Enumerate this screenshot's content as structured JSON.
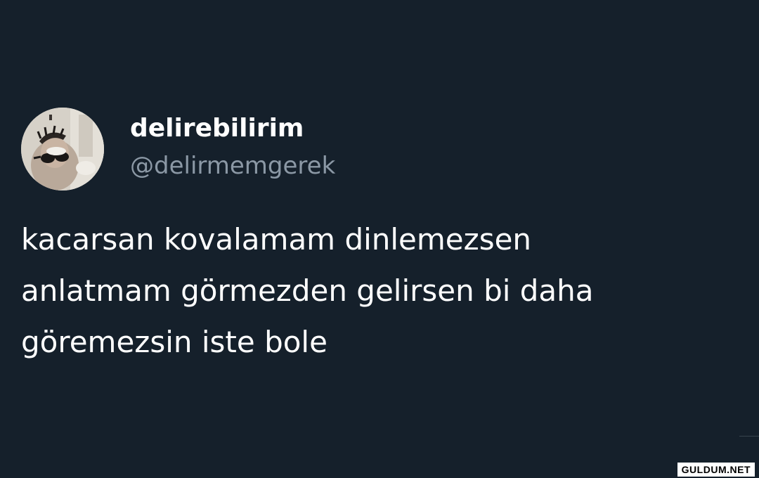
{
  "colors": {
    "background": "#15202b",
    "display_name": "#ffffff",
    "handle": "#8b98a5",
    "text": "#ffffff"
  },
  "author": {
    "display_name": "delirebilirim",
    "handle": "@delirmemgerek",
    "avatar_icon": "profile-photo"
  },
  "tweet": {
    "lines": [
      "kacarsan kovalamam dinlemezsen",
      "anlatmam görmezden gelirsen bi daha",
      "göremezsin iste bole"
    ]
  },
  "watermark": {
    "text": "GULDUM.NET"
  }
}
